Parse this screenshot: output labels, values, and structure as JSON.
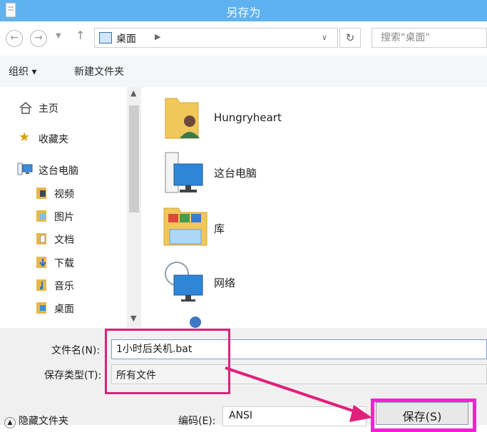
{
  "window": {
    "title": "另存为"
  },
  "address": {
    "location": "桌面",
    "search_placeholder": "搜索\"桌面\""
  },
  "toolbar": {
    "organize": "组织 ▾",
    "new_folder": "新建文件夹"
  },
  "nav": {
    "home": "主页",
    "favorites": "收藏夹",
    "this_pc": "这台电脑",
    "items": [
      "视频",
      "图片",
      "文档",
      "下载",
      "音乐",
      "桌面"
    ]
  },
  "content": {
    "items": [
      "Hungryheart",
      "这台电脑",
      "库",
      "网络"
    ]
  },
  "form": {
    "filename_label": "文件名(N):",
    "filename_value": "1小时后关机.bat",
    "filetype_label": "保存类型(T):",
    "filetype_value": "所有文件",
    "encoding_label": "编码(E):",
    "encoding_value": "ANSI",
    "save_label": "保存(S)",
    "hide_folders_label": "隐藏文件夹"
  },
  "colors": {
    "titlebar": "#5fb2f0",
    "highlight": "#e0207a",
    "save_highlight": "#ff1ed2"
  }
}
